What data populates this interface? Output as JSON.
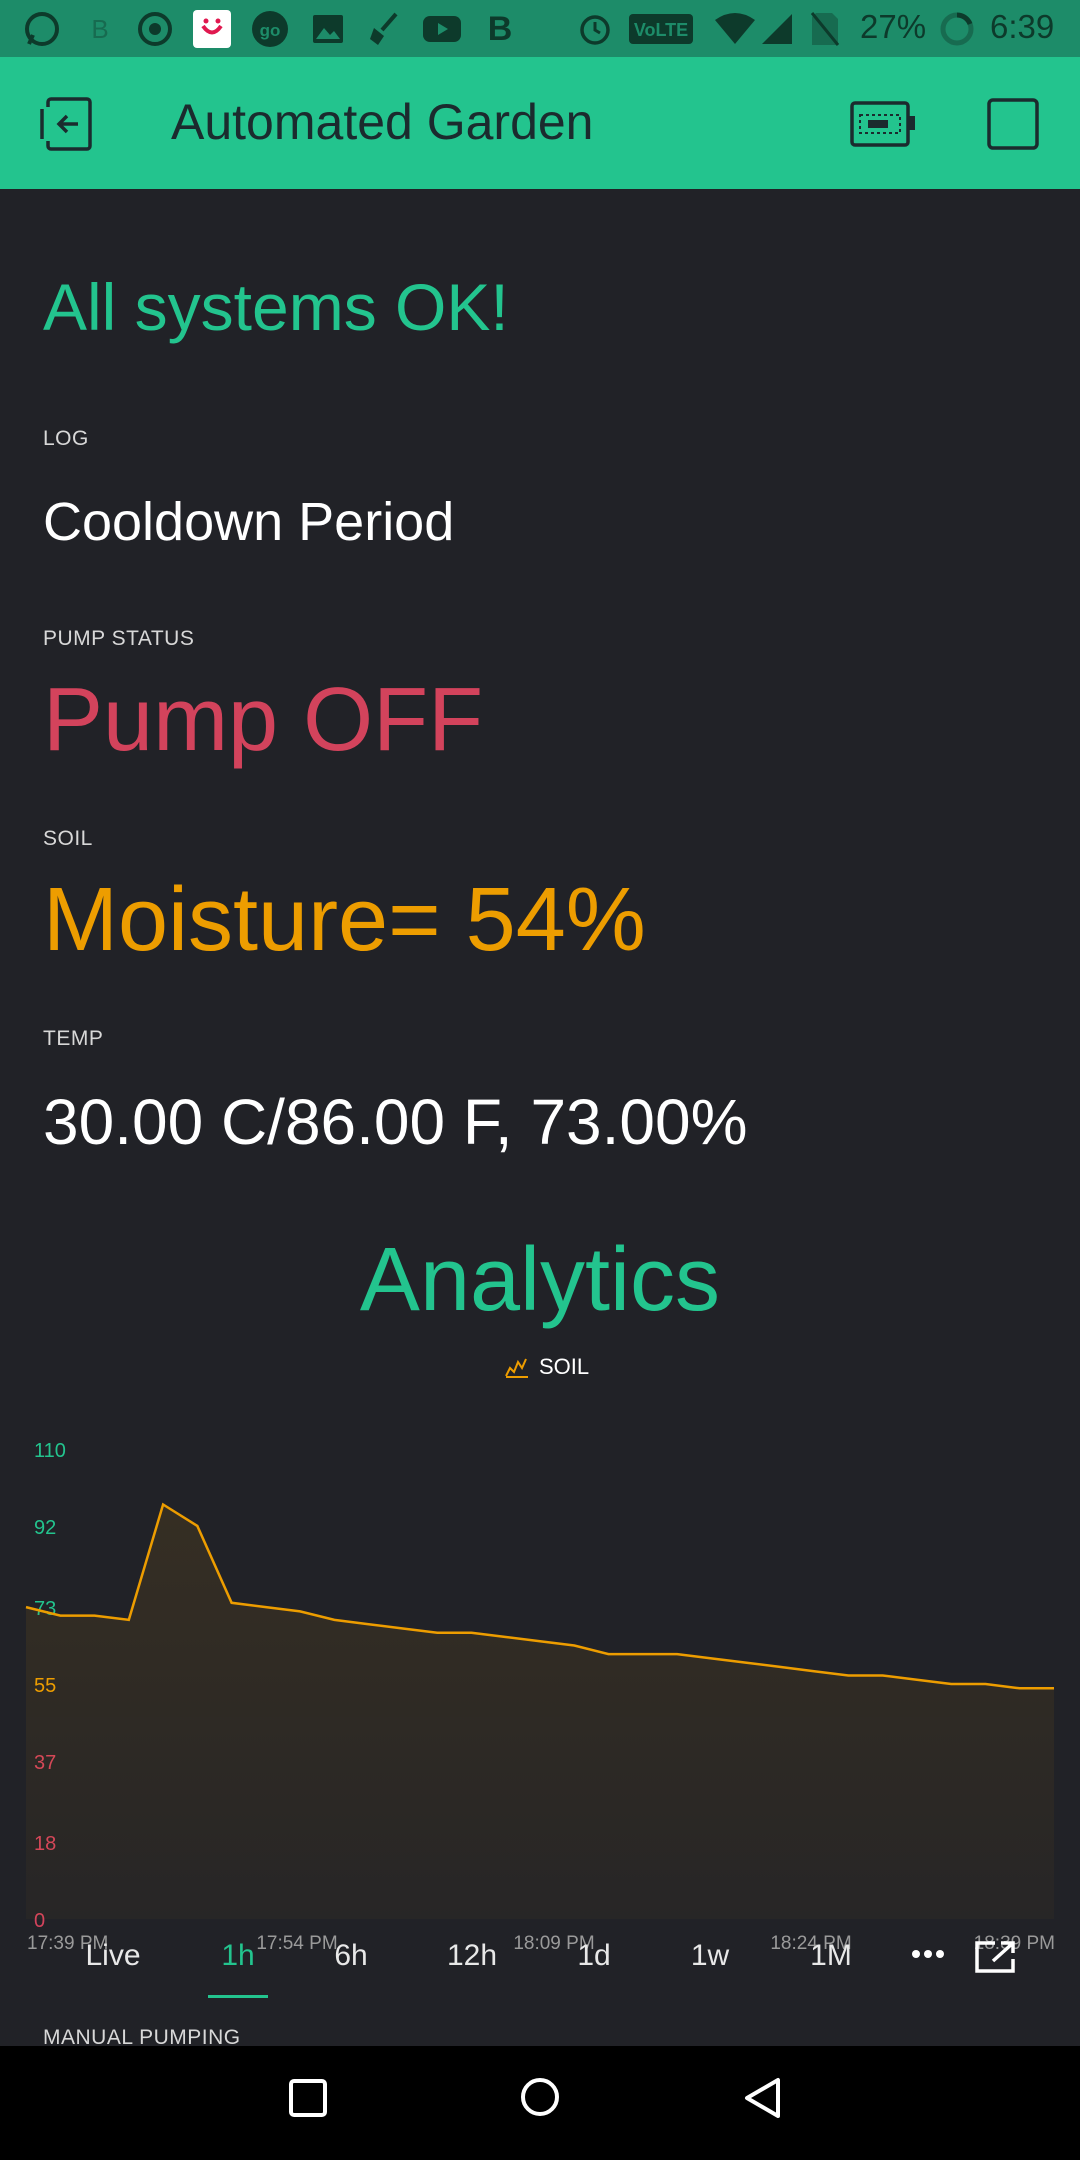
{
  "status_bar": {
    "battery": "27%",
    "time": "6:39",
    "network": "VoLTE",
    "icons": [
      "whatsapp-icon",
      "b-icon",
      "chrome-icon",
      "smile-app-icon",
      "go-icon",
      "gallery-icon",
      "broom-icon",
      "youtube-icon",
      "b-bold-icon",
      "alarm-icon",
      "volte-icon",
      "wifi-icon",
      "signal-icon",
      "no-sim-icon",
      "battery-ring-icon"
    ]
  },
  "app_bar": {
    "title": "Automated Garden",
    "accent": "#23c48e"
  },
  "widgets": {
    "headline": "All systems OK!",
    "log_label": "LOG",
    "log_value": "Cooldown Period",
    "pump_label": "PUMP STATUS",
    "pump_value": "Pump OFF",
    "soil_label": "SOIL",
    "soil_value": "Moisture= 54%",
    "temp_label": "TEMP",
    "temp_value": "30.00 C/86.00 F, 73.00%",
    "colors": {
      "headline": "#23c48e",
      "pump": "#d3435c",
      "soil": "#ed9d00",
      "text": "#ffffff"
    }
  },
  "analytics": {
    "title": "Analytics",
    "legend": "SOIL",
    "y_ticks": [
      "110",
      "92",
      "73",
      "55",
      "37",
      "18",
      "0"
    ],
    "x_ticks": [
      "17:39 PM",
      "17:54 PM",
      "18:09 PM",
      "18:24 PM",
      "18:39 PM"
    ],
    "tabs": [
      "Live",
      "1h",
      "6h",
      "12h",
      "1d",
      "1w",
      "1M"
    ],
    "active_tab": "1h",
    "more_icon": "more-dots-icon",
    "export_icon": "open-external-icon"
  },
  "chart_data": {
    "type": "area",
    "series": [
      {
        "name": "SOIL",
        "x": [
          "17:39",
          "17:41",
          "17:43",
          "17:45",
          "17:47",
          "17:49",
          "17:51",
          "17:53",
          "17:55",
          "17:57",
          "17:59",
          "18:01",
          "18:03",
          "18:05",
          "18:07",
          "18:09",
          "18:11",
          "18:13",
          "18:15",
          "18:17",
          "18:19",
          "18:21",
          "18:23",
          "18:25",
          "18:27",
          "18:29",
          "18:31",
          "18:33",
          "18:35",
          "18:37",
          "18:39"
        ],
        "values": [
          73,
          71,
          71,
          70,
          97,
          92,
          74,
          73,
          72,
          70,
          69,
          68,
          67,
          67,
          66,
          65,
          64,
          62,
          62,
          62,
          61,
          60,
          59,
          58,
          57,
          57,
          56,
          55,
          55,
          54,
          54
        ]
      }
    ],
    "ylim": [
      0,
      110
    ],
    "line_color": "#ed9d00",
    "ylabel": "",
    "xlabel": ""
  },
  "next_section": {
    "label": "MANUAL PUMPING"
  },
  "nav_bar": {
    "icons": [
      "recent-apps-icon",
      "home-icon",
      "back-icon"
    ]
  }
}
